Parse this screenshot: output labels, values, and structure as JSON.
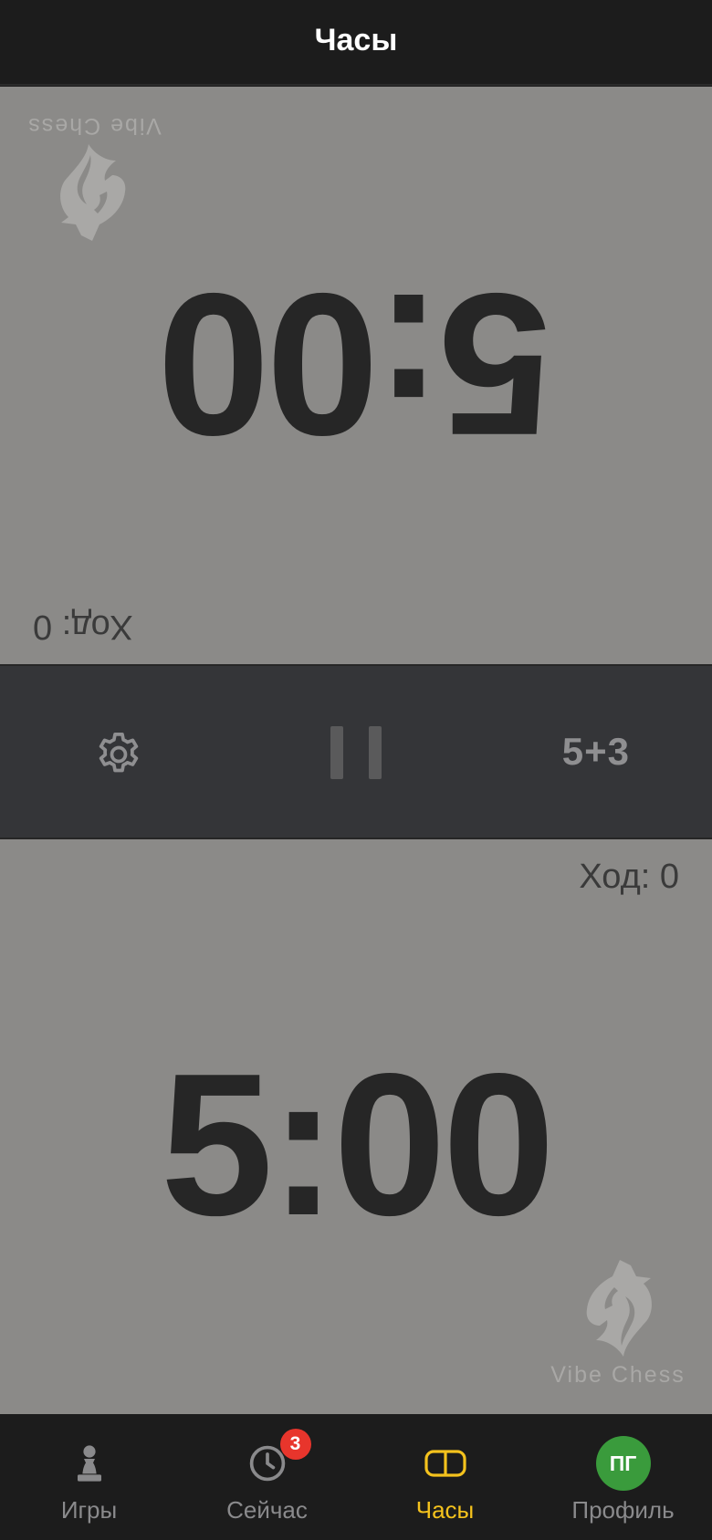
{
  "header": {
    "title": "Часы"
  },
  "top_player": {
    "time": "5:00",
    "moves_label": "Ход: 0",
    "logo_text": "Vibe Chess"
  },
  "controls": {
    "settings_icon": "gear-icon",
    "pause_icon": "pause-icon",
    "time_control": "5+3"
  },
  "bottom_player": {
    "time": "5:00",
    "moves_label": "Ход: 0",
    "logo_text": "Vibe Chess"
  },
  "tabbar": {
    "items": [
      {
        "label": "Игры",
        "icon": "pawn-icon",
        "active": false
      },
      {
        "label": "Сейчас",
        "icon": "clock-icon",
        "badge": "3",
        "active": false
      },
      {
        "label": "Часы",
        "icon": "chess-clock-icon",
        "active": true
      },
      {
        "label": "Профиль",
        "icon": "avatar",
        "avatar_initials": "ПГ",
        "active": false
      }
    ]
  },
  "colors": {
    "panel_bg": "#8b8a88",
    "control_bar_bg": "#343538",
    "accent": "#f4c21d",
    "badge": "#e8352c",
    "avatar_bg": "#3a9b3c"
  }
}
